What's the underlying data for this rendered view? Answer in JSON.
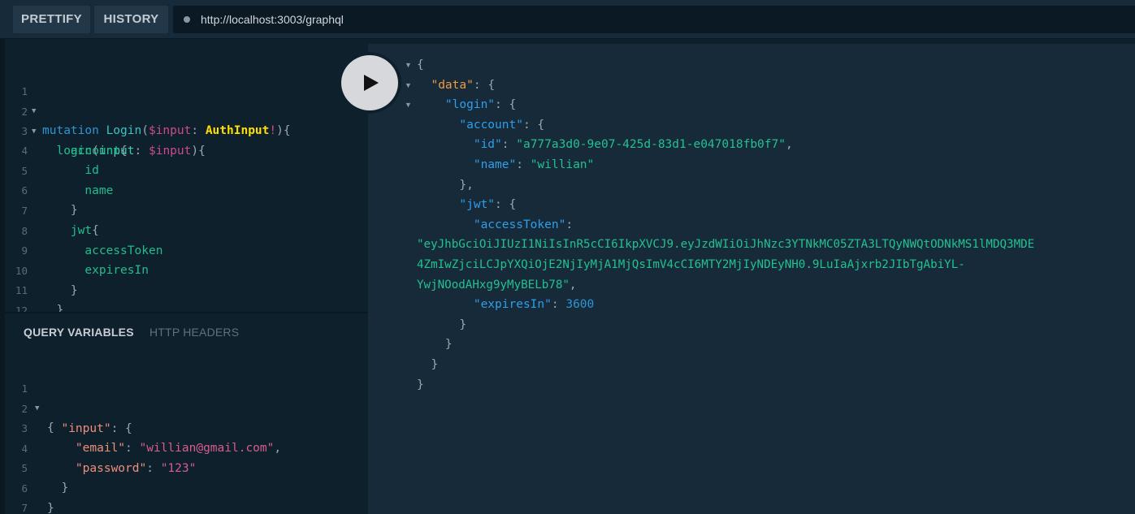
{
  "toolbar": {
    "prettify_label": "PRETTIFY",
    "history_label": "HISTORY",
    "url": "http://localhost:3003/graphql"
  },
  "editor": {
    "line_numbers": [
      "1",
      "2",
      "3",
      "4",
      "5",
      "6",
      "7",
      "8",
      "9",
      "10",
      "11",
      "12"
    ],
    "tokens": {
      "mutation": "mutation",
      "op_name": "Login",
      "var_input": "$input",
      "type_name": "AuthInput",
      "bang": "!",
      "login": "login",
      "input_arg": "input",
      "account": "account",
      "id": "id",
      "name": "name",
      "jwt": "jwt",
      "accessToken": "accessToken",
      "expiresIn": "expiresIn"
    }
  },
  "variables_panel": {
    "tab_query_variables": "QUERY VARIABLES",
    "tab_http_headers": "HTTP HEADERS",
    "line_numbers": [
      "1",
      "2",
      "3",
      "4",
      "5",
      "6",
      "7"
    ],
    "keys": {
      "input": "\"input\"",
      "email": "\"email\"",
      "password": "\"password\""
    },
    "values": {
      "email": "\"willian@gmail.com\"",
      "password": "\"123\""
    }
  },
  "result": {
    "keys": {
      "data": "\"data\"",
      "login": "\"login\"",
      "account": "\"account\"",
      "id": "\"id\"",
      "name": "\"name\"",
      "jwt": "\"jwt\"",
      "accessToken": "\"accessToken\"",
      "expiresIn": "\"expiresIn\""
    },
    "values": {
      "id": "\"a777a3d0-9e07-425d-83d1-e047018fb0f7\"",
      "name": "\"willian\"",
      "token_line1": "\"eyJhbGciOiJIUzI1NiIsInR5cCI6IkpXVCJ9.eyJzdWIiOiJhNzc3YTNkMC05ZTA3LTQyNWQtODNkMS1lMDQ3MDE",
      "token_line2": "4ZmIwZjciLCJpYXQiOjE2NjIyMjA1MjQsImV4cCI6MTY2MjIyNDEyNH0.9LuIaAjxrb2JIbTgAbiYL-",
      "token_line3": "YwjNOodAHxg9yMyBELb78\"",
      "expiresIn": "3600"
    }
  },
  "colors": {
    "background": "#0f202d",
    "result_background": "#172a3a",
    "keyword": "#2e95d3",
    "field": "#23bc8e",
    "variable": "#cb4b8f",
    "type": "#ffdf00",
    "data_key": "#f39a3e"
  },
  "icons": {
    "run": "play-icon",
    "fold": "fold-arrow-icon",
    "status": "status-dot-icon"
  }
}
